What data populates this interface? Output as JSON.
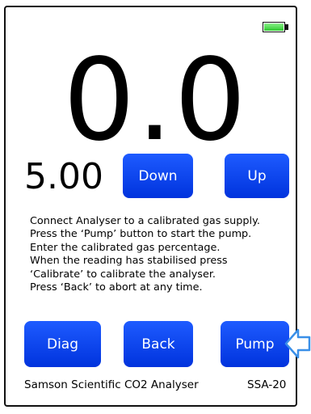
{
  "battery": {
    "level": 1.0,
    "color": "#2ec82e",
    "icon": "battery-full-icon"
  },
  "display": {
    "reading": "0.0",
    "setpoint": "5.00"
  },
  "buttons": {
    "down": "Down",
    "up": "Up",
    "diag": "Diag",
    "back": "Back",
    "pump": "Pump"
  },
  "instructions": [
    "Connect Analyser to a calibrated gas supply.",
    "Press the ‘Pump’ button to start the pump.",
    "Enter the calibrated gas percentage.",
    "When the reading has stabilised press",
    "‘Calibrate’ to calibrate the analyser.",
    "Press ‘Back’ to abort at any time."
  ],
  "footer": {
    "product": "Samson Scientific CO2 Analyser",
    "model": "SSA-20"
  },
  "colors": {
    "button": "#0033dd",
    "pointer": "#3a8fe8"
  }
}
